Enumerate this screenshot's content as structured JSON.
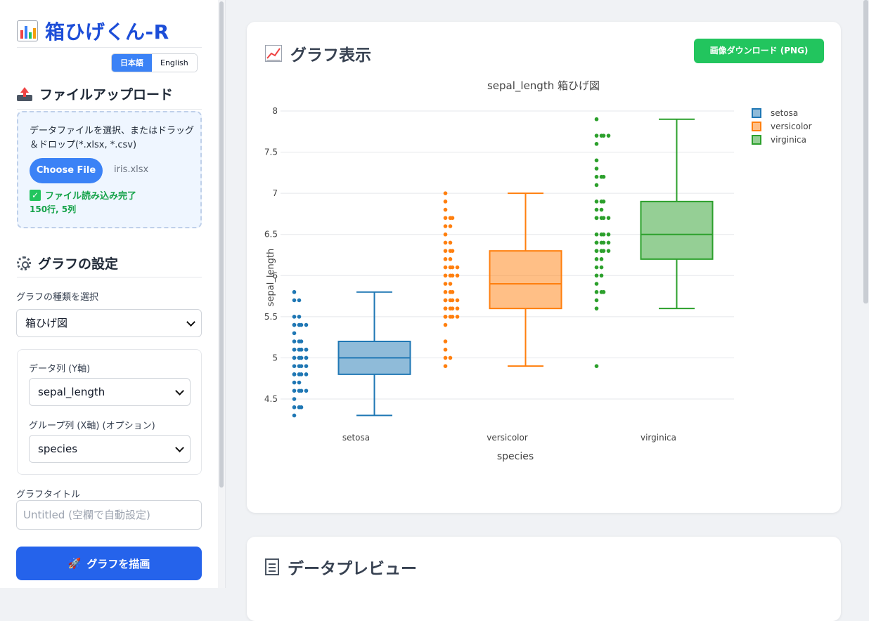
{
  "app": {
    "title": "箱ひげくん-R"
  },
  "language": {
    "ja": "日本語",
    "en": "English"
  },
  "upload": {
    "section_title": "ファイルアップロード",
    "instructions": "データファイルを選択、またはドラッグ＆ドロップ(*.xlsx, *.csv)",
    "choose_button": "Choose File",
    "file_name": "iris.xlsx",
    "status": "ファイル読み込み完了",
    "rows_cols": "150行, 5列"
  },
  "settings": {
    "section_title": "グラフの設定",
    "chart_type_label": "グラフの種類を選択",
    "chart_type_value": "箱ひげ図",
    "y_label": "データ列 (Y軸)",
    "y_value": "sepal_length",
    "x_label": "グループ列 (X軸) (オプション)",
    "x_value": "species",
    "title_label": "グラフタイトル",
    "title_placeholder": "Untitled (空欄で自動設定)",
    "draw_button": "グラフを描画"
  },
  "graph": {
    "card_title": "グラフ表示",
    "download_button": "画像ダウンロード (PNG)"
  },
  "preview": {
    "card_title": "データプレビュー"
  },
  "colors": {
    "setosa": "#1f77b4",
    "versicolor": "#ff7f0e",
    "virginica": "#2ca02c",
    "primary": "#2563eb",
    "success": "#22c55e"
  },
  "chart_data": {
    "type": "box",
    "title": "sepal_length 箱ひげ図",
    "xlabel": "species",
    "ylabel": "sepal_length",
    "ylim": [
      4.3,
      8.0
    ],
    "yticks": [
      4.5,
      5,
      5.5,
      6,
      6.5,
      7,
      7.5,
      8
    ],
    "ytick_labels": [
      "4.5",
      "5",
      "5.5",
      "6",
      "6.5",
      "7",
      "7.5",
      "8"
    ],
    "categories": [
      "setosa",
      "versicolor",
      "virginica"
    ],
    "legend_position": "top-right",
    "grid": true,
    "series": [
      {
        "name": "setosa",
        "color": "#1f77b4",
        "min": 4.3,
        "q1": 4.8,
        "median": 5.0,
        "q3": 5.2,
        "max": 5.8,
        "points": [
          5.1,
          4.9,
          4.7,
          4.6,
          5.0,
          5.4,
          4.6,
          5.0,
          4.4,
          4.9,
          5.4,
          4.8,
          4.8,
          4.3,
          5.8,
          5.7,
          5.4,
          5.1,
          5.7,
          5.1,
          5.4,
          5.1,
          4.6,
          5.1,
          4.8,
          5.0,
          5.0,
          5.2,
          5.2,
          4.7,
          4.8,
          5.4,
          5.2,
          5.5,
          4.9,
          5.0,
          5.5,
          4.9,
          4.4,
          5.1,
          5.0,
          4.5,
          4.4,
          5.0,
          5.1,
          4.8,
          5.1,
          4.6,
          5.3,
          5.0
        ]
      },
      {
        "name": "versicolor",
        "color": "#ff7f0e",
        "min": 4.9,
        "q1": 5.6,
        "median": 5.9,
        "q3": 6.3,
        "max": 7.0,
        "points": [
          7.0,
          6.4,
          6.9,
          5.5,
          6.5,
          5.7,
          6.3,
          4.9,
          6.6,
          5.2,
          5.0,
          5.9,
          6.0,
          6.1,
          5.6,
          6.7,
          5.6,
          5.8,
          6.2,
          5.6,
          5.9,
          6.1,
          6.3,
          6.1,
          6.4,
          6.6,
          6.8,
          6.7,
          6.0,
          5.7,
          5.5,
          5.5,
          5.8,
          6.0,
          5.4,
          6.0,
          6.7,
          6.3,
          5.6,
          5.5,
          5.5,
          6.1,
          5.8,
          5.0,
          5.6,
          5.7,
          5.7,
          6.2,
          5.1,
          5.7
        ]
      },
      {
        "name": "virginica",
        "color": "#2ca02c",
        "min": 5.6,
        "q1": 6.2,
        "median": 6.5,
        "q3": 6.9,
        "max": 7.9,
        "points": [
          6.3,
          5.8,
          7.1,
          6.3,
          6.5,
          7.6,
          4.9,
          7.3,
          6.7,
          7.2,
          6.5,
          6.4,
          6.8,
          5.7,
          5.8,
          6.4,
          6.5,
          7.7,
          7.7,
          6.0,
          6.9,
          5.6,
          7.7,
          6.3,
          6.7,
          7.2,
          6.2,
          6.1,
          6.4,
          7.2,
          7.4,
          7.9,
          6.4,
          6.3,
          6.1,
          7.7,
          6.3,
          6.4,
          6.0,
          6.9,
          6.7,
          6.9,
          5.8,
          6.8,
          6.7,
          6.7,
          6.3,
          6.5,
          6.2,
          5.9
        ]
      }
    ]
  }
}
